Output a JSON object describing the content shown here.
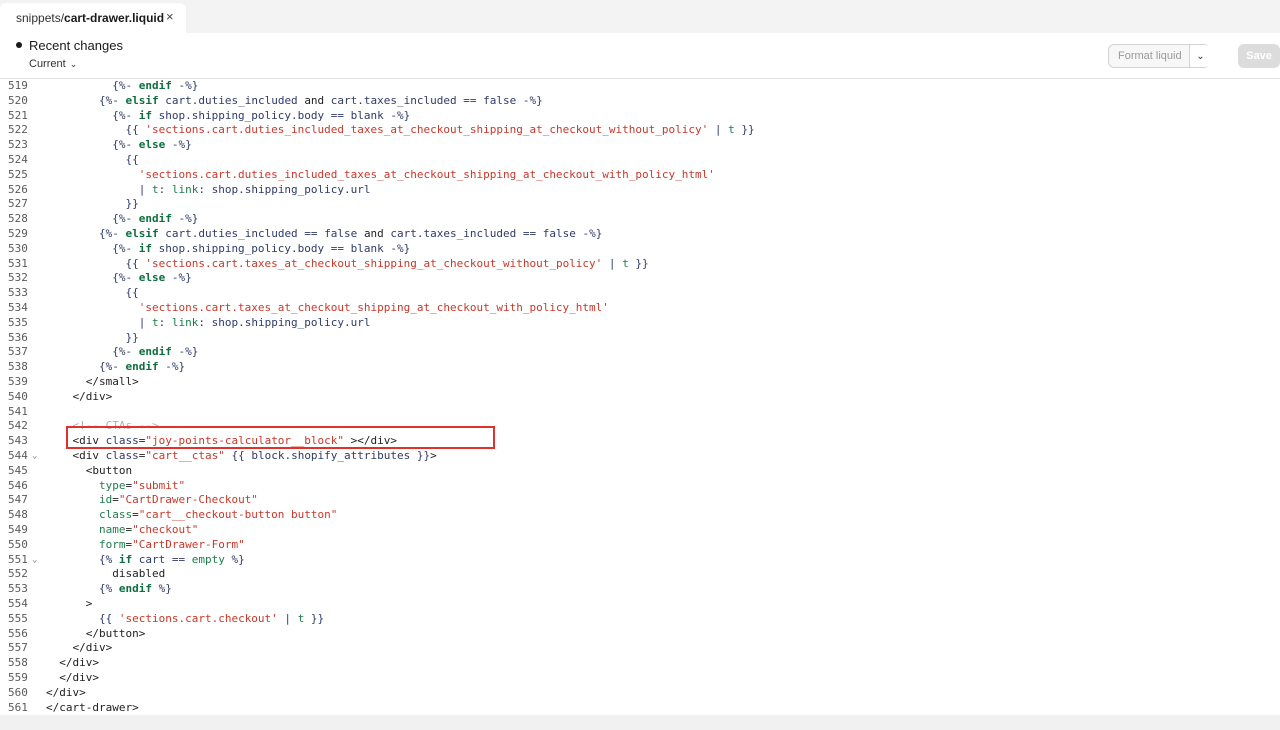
{
  "tab": {
    "path": "snippets/",
    "file": "cart-drawer.liquid",
    "close": "×"
  },
  "header": {
    "recent_changes": "Recent changes",
    "current": "Current",
    "format_label": "Format liquid",
    "save_label": "Save"
  },
  "editor": {
    "lines": [
      {
        "n": "519",
        "fold": "",
        "tokens": [
          [
            "d",
            "          {%- "
          ],
          [
            "k",
            "endif"
          ],
          [
            "d",
            " -%}"
          ]
        ]
      },
      {
        "n": "520",
        "fold": "",
        "tokens": [
          [
            "d",
            "        {%- "
          ],
          [
            "k",
            "elsif"
          ],
          [
            "d",
            " cart.duties_included "
          ],
          [
            "",
            "and"
          ],
          [
            "d",
            " cart.taxes_included == "
          ],
          [
            "d",
            "false"
          ],
          [
            "d",
            " -%}"
          ]
        ]
      },
      {
        "n": "521",
        "fold": "",
        "tokens": [
          [
            "d",
            "          {%- "
          ],
          [
            "k",
            "if"
          ],
          [
            "d",
            " shop.shipping_policy.body == blank -%}"
          ]
        ]
      },
      {
        "n": "522",
        "fold": "",
        "tokens": [
          [
            "d",
            "            {{ "
          ],
          [
            "s",
            "'sections.cart.duties_included_taxes_at_checkout_shipping_at_checkout_without_policy'"
          ],
          [
            "d",
            " | "
          ],
          [
            "f",
            "t"
          ],
          [
            "d",
            " }}"
          ]
        ]
      },
      {
        "n": "523",
        "fold": "",
        "tokens": [
          [
            "d",
            "          {%- "
          ],
          [
            "k",
            "else"
          ],
          [
            "d",
            " -%}"
          ]
        ]
      },
      {
        "n": "524",
        "fold": "",
        "tokens": [
          [
            "d",
            "            {{"
          ]
        ]
      },
      {
        "n": "525",
        "fold": "",
        "tokens": [
          [
            "s",
            "              'sections.cart.duties_included_taxes_at_checkout_shipping_at_checkout_with_policy_html'"
          ]
        ]
      },
      {
        "n": "526",
        "fold": "",
        "tokens": [
          [
            "d",
            "              | "
          ],
          [
            "f",
            "t"
          ],
          [
            "d",
            ": "
          ],
          [
            "f",
            "link"
          ],
          [
            "d",
            ": shop.shipping_policy.url"
          ]
        ]
      },
      {
        "n": "527",
        "fold": "",
        "tokens": [
          [
            "d",
            "            }}"
          ]
        ]
      },
      {
        "n": "528",
        "fold": "",
        "tokens": [
          [
            "d",
            "          {%- "
          ],
          [
            "k",
            "endif"
          ],
          [
            "d",
            " -%}"
          ]
        ]
      },
      {
        "n": "529",
        "fold": "",
        "tokens": [
          [
            "d",
            "        {%- "
          ],
          [
            "k",
            "elsif"
          ],
          [
            "d",
            " cart.duties_included == "
          ],
          [
            "d",
            "false"
          ],
          [
            "d",
            " "
          ],
          [
            "",
            "and"
          ],
          [
            "d",
            " cart.taxes_included == "
          ],
          [
            "d",
            "false"
          ],
          [
            "d",
            " -%}"
          ]
        ]
      },
      {
        "n": "530",
        "fold": "",
        "tokens": [
          [
            "d",
            "          {%- "
          ],
          [
            "k",
            "if"
          ],
          [
            "d",
            " shop.shipping_policy.body == blank -%}"
          ]
        ]
      },
      {
        "n": "531",
        "fold": "",
        "tokens": [
          [
            "d",
            "            {{ "
          ],
          [
            "s",
            "'sections.cart.taxes_at_checkout_shipping_at_checkout_without_policy'"
          ],
          [
            "d",
            " | "
          ],
          [
            "f",
            "t"
          ],
          [
            "d",
            " }}"
          ]
        ]
      },
      {
        "n": "532",
        "fold": "",
        "tokens": [
          [
            "d",
            "          {%- "
          ],
          [
            "k",
            "else"
          ],
          [
            "d",
            " -%}"
          ]
        ]
      },
      {
        "n": "533",
        "fold": "",
        "tokens": [
          [
            "d",
            "            {{"
          ]
        ]
      },
      {
        "n": "534",
        "fold": "",
        "tokens": [
          [
            "s",
            "              'sections.cart.taxes_at_checkout_shipping_at_checkout_with_policy_html'"
          ]
        ]
      },
      {
        "n": "535",
        "fold": "",
        "tokens": [
          [
            "d",
            "              | "
          ],
          [
            "f",
            "t"
          ],
          [
            "d",
            ": "
          ],
          [
            "f",
            "link"
          ],
          [
            "d",
            ": shop.shipping_policy.url"
          ]
        ]
      },
      {
        "n": "536",
        "fold": "",
        "tokens": [
          [
            "d",
            "            }}"
          ]
        ]
      },
      {
        "n": "537",
        "fold": "",
        "tokens": [
          [
            "d",
            "          {%- "
          ],
          [
            "k",
            "endif"
          ],
          [
            "d",
            " -%}"
          ]
        ]
      },
      {
        "n": "538",
        "fold": "",
        "tokens": [
          [
            "d",
            "        {%- "
          ],
          [
            "k",
            "endif"
          ],
          [
            "d",
            " -%}"
          ]
        ]
      },
      {
        "n": "539",
        "fold": "",
        "tokens": [
          [
            "",
            "      </small>"
          ]
        ]
      },
      {
        "n": "540",
        "fold": "",
        "tokens": [
          [
            "",
            "    </div>"
          ]
        ]
      },
      {
        "n": "541",
        "fold": "",
        "tokens": [
          [
            "",
            ""
          ]
        ]
      },
      {
        "n": "542",
        "fold": "",
        "tokens": [
          [
            "cm",
            "    <!-- CTAs -->"
          ]
        ]
      },
      {
        "n": "543",
        "fold": "",
        "tokens": [
          [
            "",
            "    <div "
          ],
          [
            "d",
            "class"
          ],
          [
            "",
            "="
          ],
          [
            "s",
            "\"joy-points-calculator__block\""
          ],
          [
            "",
            " ></div>"
          ]
        ]
      },
      {
        "n": "544",
        "fold": "⌄",
        "tokens": [
          [
            "",
            "    <div "
          ],
          [
            "d",
            "class"
          ],
          [
            "",
            "="
          ],
          [
            "s",
            "\"cart__ctas\""
          ],
          [
            "d",
            " {{ block.shopify_attributes }}"
          ],
          [
            "",
            ">"
          ]
        ]
      },
      {
        "n": "545",
        "fold": "",
        "tokens": [
          [
            "",
            "      <button"
          ]
        ]
      },
      {
        "n": "546",
        "fold": "",
        "tokens": [
          [
            "f",
            "        type"
          ],
          [
            "",
            "="
          ],
          [
            "s",
            "\"submit\""
          ]
        ]
      },
      {
        "n": "547",
        "fold": "",
        "tokens": [
          [
            "f",
            "        id"
          ],
          [
            "",
            "="
          ],
          [
            "s",
            "\"CartDrawer-Checkout\""
          ]
        ]
      },
      {
        "n": "548",
        "fold": "",
        "tokens": [
          [
            "f",
            "        class"
          ],
          [
            "",
            "="
          ],
          [
            "s",
            "\"cart__checkout-button button\""
          ]
        ]
      },
      {
        "n": "549",
        "fold": "",
        "tokens": [
          [
            "f",
            "        name"
          ],
          [
            "",
            "="
          ],
          [
            "s",
            "\"checkout\""
          ]
        ]
      },
      {
        "n": "550",
        "fold": "",
        "tokens": [
          [
            "f",
            "        form"
          ],
          [
            "",
            "="
          ],
          [
            "s",
            "\"CartDrawer-Form\""
          ]
        ]
      },
      {
        "n": "551",
        "fold": "⌄",
        "tokens": [
          [
            "d",
            "        {% "
          ],
          [
            "k",
            "if"
          ],
          [
            "d",
            " cart == "
          ],
          [
            "f",
            "empty"
          ],
          [
            "d",
            " %}"
          ]
        ]
      },
      {
        "n": "552",
        "fold": "",
        "tokens": [
          [
            "",
            "          disabled"
          ]
        ]
      },
      {
        "n": "553",
        "fold": "",
        "tokens": [
          [
            "d",
            "        {% "
          ],
          [
            "k",
            "endif"
          ],
          [
            "d",
            " %}"
          ]
        ]
      },
      {
        "n": "554",
        "fold": "",
        "tokens": [
          [
            "",
            "      >"
          ]
        ]
      },
      {
        "n": "555",
        "fold": "",
        "tokens": [
          [
            "d",
            "        {{ "
          ],
          [
            "s",
            "'sections.cart.checkout'"
          ],
          [
            "d",
            " | "
          ],
          [
            "f",
            "t"
          ],
          [
            "d",
            " }}"
          ]
        ]
      },
      {
        "n": "556",
        "fold": "",
        "tokens": [
          [
            "",
            "      </button>"
          ]
        ]
      },
      {
        "n": "557",
        "fold": "",
        "tokens": [
          [
            "",
            "    </div>"
          ]
        ]
      },
      {
        "n": "558",
        "fold": "",
        "tokens": [
          [
            "",
            "  </div>"
          ]
        ]
      },
      {
        "n": "559",
        "fold": "",
        "tokens": [
          [
            "",
            "  </div>"
          ]
        ]
      },
      {
        "n": "560",
        "fold": "",
        "tokens": [
          [
            "",
            "</div>"
          ]
        ]
      },
      {
        "n": "561",
        "fold": "",
        "tokens": [
          [
            "",
            "</cart-drawer>"
          ]
        ]
      }
    ]
  },
  "colors": {
    "highlight": "#e0312a",
    "keyword": "#0d6e3f",
    "string": "#c8382a"
  }
}
